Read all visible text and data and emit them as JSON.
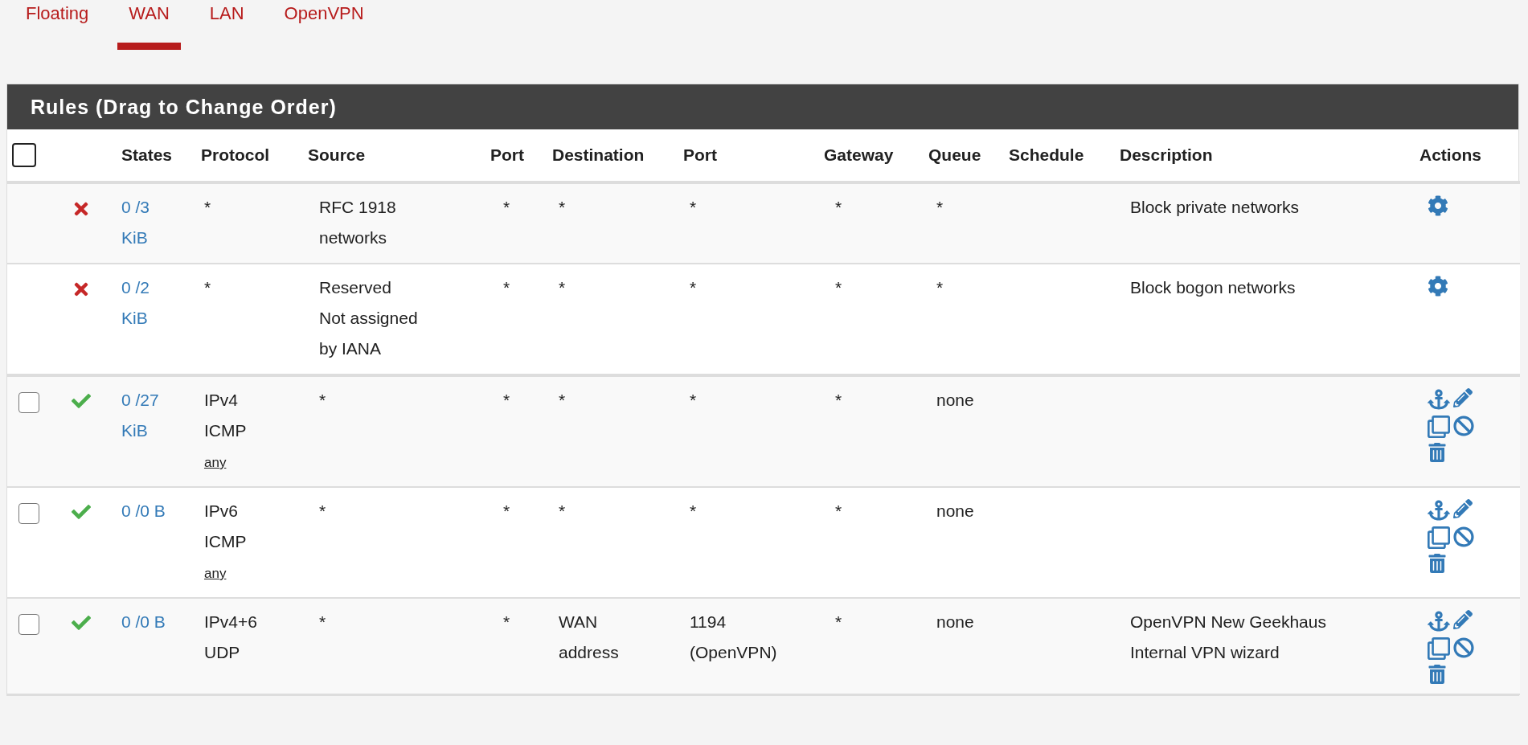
{
  "tabs": [
    {
      "label": "Floating",
      "selected": false
    },
    {
      "label": "WAN",
      "selected": true
    },
    {
      "label": "LAN",
      "selected": false
    },
    {
      "label": "OpenVPN",
      "selected": false
    }
  ],
  "panel": {
    "title": "Rules (Drag to Change Order)"
  },
  "table": {
    "select_all": {
      "checked": false
    },
    "columns": [
      "States",
      "Protocol",
      "Source",
      "Port",
      "Destination",
      "Port",
      "Gateway",
      "Queue",
      "Schedule",
      "Description",
      "Actions"
    ],
    "rows": [
      {
        "kind": "block",
        "system": true,
        "states": [
          "0 /3",
          "KiB"
        ],
        "protocol": [
          "*"
        ],
        "source": [
          "RFC 1918",
          "networks"
        ],
        "source_port": "*",
        "destination": [
          "*"
        ],
        "destination_port": [
          "*"
        ],
        "gateway": "*",
        "queue": "*",
        "description": [
          "Block private networks"
        ]
      },
      {
        "kind": "block",
        "system": true,
        "states": [
          "0 /2",
          "KiB"
        ],
        "protocol": [
          "*"
        ],
        "source": [
          "Reserved",
          "Not assigned",
          "by IANA"
        ],
        "source_port": "*",
        "destination": [
          "*"
        ],
        "destination_port": [
          "*"
        ],
        "gateway": "*",
        "queue": "*",
        "description": [
          "Block bogon networks"
        ]
      },
      {
        "kind": "pass",
        "system": false,
        "checked": false,
        "states": [
          "0 /27",
          "KiB"
        ],
        "protocol": [
          "IPv4",
          "ICMP"
        ],
        "icmp_type": "any",
        "source": [
          "*"
        ],
        "source_port": "*",
        "destination": [
          "*"
        ],
        "destination_port": [
          "*"
        ],
        "gateway": "*",
        "queue": "none"
      },
      {
        "kind": "pass",
        "system": false,
        "checked": false,
        "states": [
          "0 /0 B"
        ],
        "protocol": [
          "IPv6",
          "ICMP"
        ],
        "icmp_type": "any",
        "source": [
          "*"
        ],
        "source_port": "*",
        "destination": [
          "*"
        ],
        "destination_port": [
          "*"
        ],
        "gateway": "*",
        "queue": "none"
      },
      {
        "kind": "pass",
        "system": false,
        "checked": false,
        "states": [
          "0 /0 B"
        ],
        "protocol": [
          "IPv4+6",
          "UDP"
        ],
        "source": [
          "*"
        ],
        "source_port": "*",
        "destination": [
          "WAN",
          "address"
        ],
        "destination_port": [
          "1194",
          "(OpenVPN)"
        ],
        "gateway": "*",
        "queue": "none",
        "description": [
          "OpenVPN New Geekhaus",
          "Internal VPN wizard"
        ]
      }
    ]
  }
}
